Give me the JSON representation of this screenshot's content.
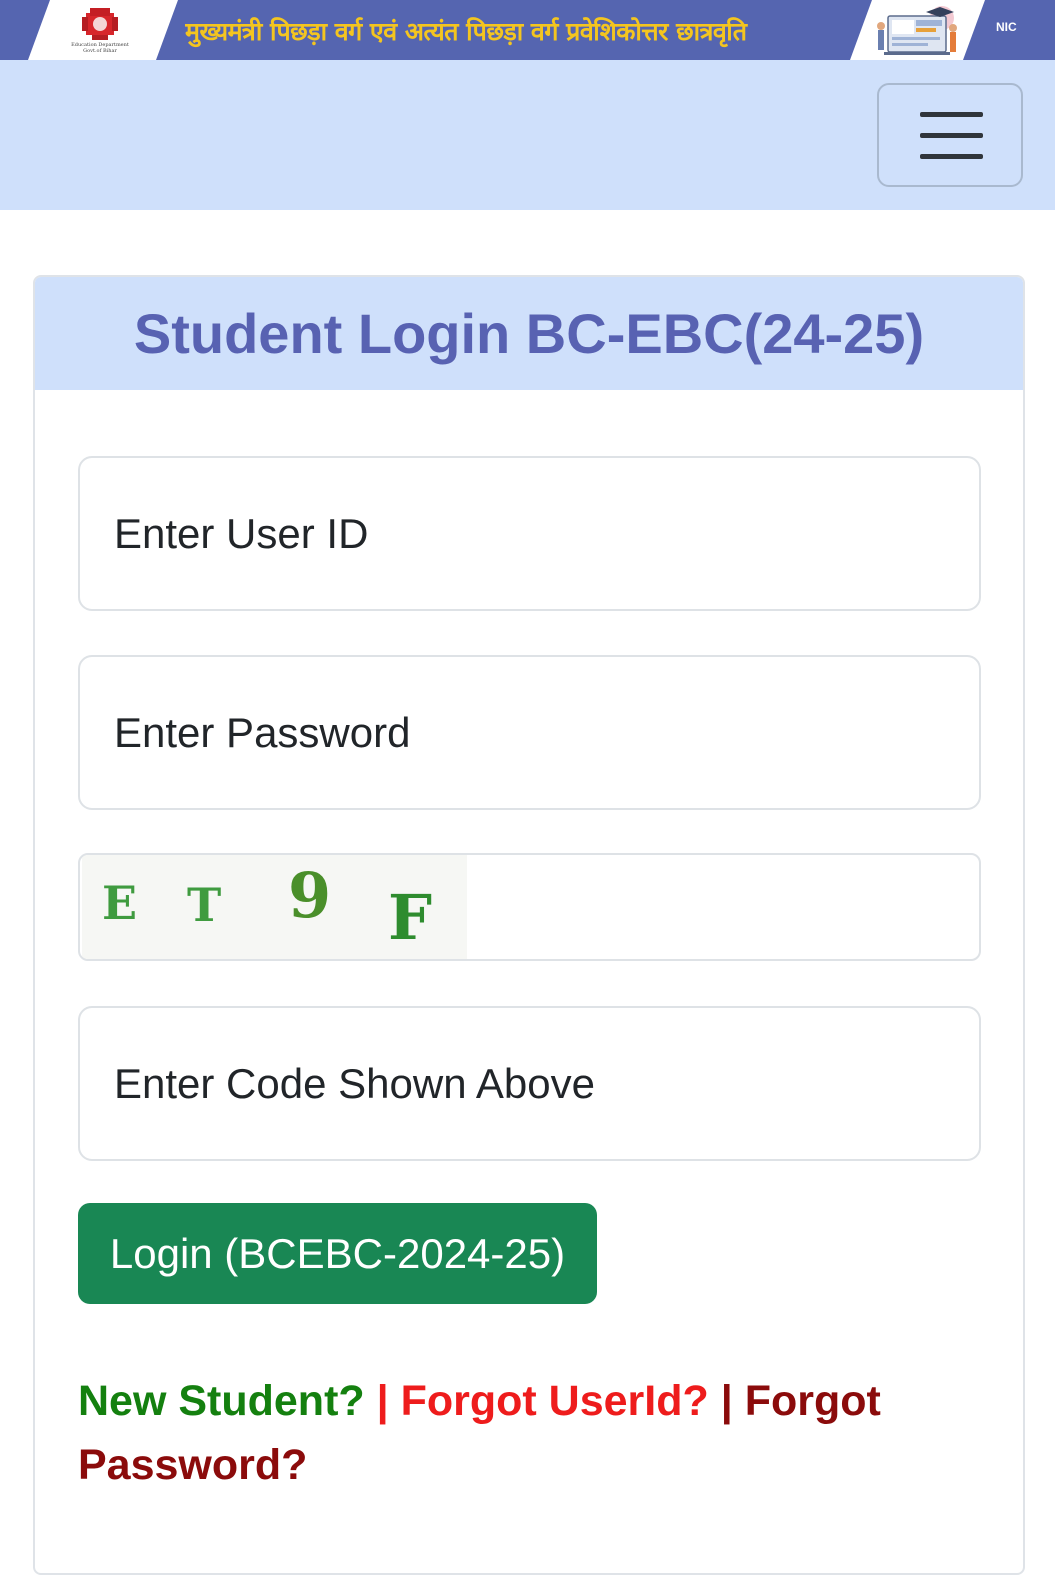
{
  "banner": {
    "title": "मुख्यमंत्री पिछड़ा वर्ग एवं अत्यंत पिछड़ा वर्ग प्रवेशिकोत्तर छात्रवृति",
    "emblem_icon": "bihar-govt-emblem-icon",
    "emblem_caption": "Education Department Govt.of Bihar",
    "illustration_icon": "scholarship-illustration-icon",
    "nic_text": "NIC",
    "brand_color": "#5565b0",
    "title_color": "#f4c51f"
  },
  "navbar": {
    "toggler_icon": "hamburger-menu-icon",
    "background": "#cfe0fb"
  },
  "login": {
    "title": "Student Login BC-EBC(24-25)",
    "user_id_placeholder": "Enter User ID",
    "password_placeholder": "Enter Password",
    "captcha_text": "ET9F",
    "captcha_code_placeholder": "Enter Code Shown Above",
    "submit_label": "Login (BCEBC-2024-25)",
    "submit_color": "#198754"
  },
  "links": {
    "new_student": "New Student?",
    "separator": "|",
    "forgot_userid": "Forgot UserId?",
    "forgot_password": "Forgot Password?",
    "new_student_color": "#14800f",
    "forgot_userid_color": "#ee1c1c",
    "forgot_password_color": "#8b0b0b"
  }
}
